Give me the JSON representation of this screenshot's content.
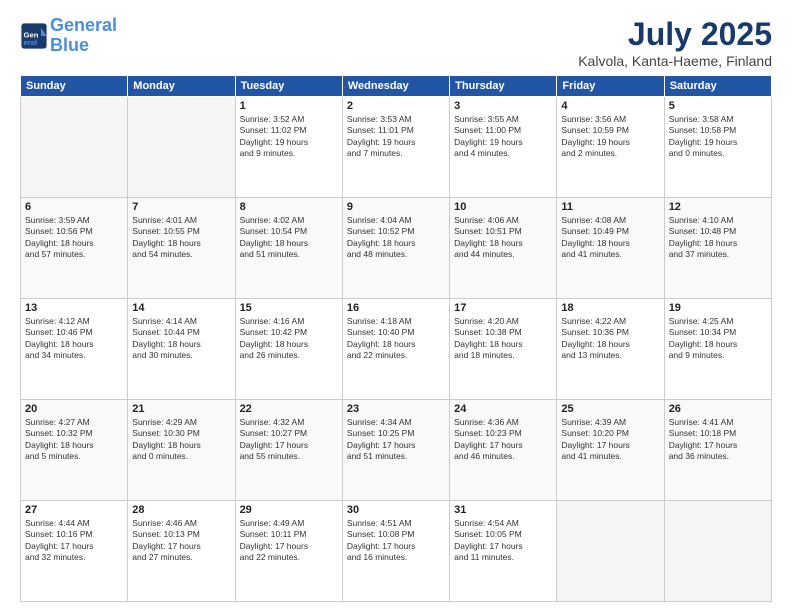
{
  "logo": {
    "line1": "General",
    "line2": "Blue"
  },
  "title": "July 2025",
  "subtitle": "Kalvola, Kanta-Haeme, Finland",
  "days_header": [
    "Sunday",
    "Monday",
    "Tuesday",
    "Wednesday",
    "Thursday",
    "Friday",
    "Saturday"
  ],
  "weeks": [
    [
      {
        "day": "",
        "info": ""
      },
      {
        "day": "",
        "info": ""
      },
      {
        "day": "1",
        "info": "Sunrise: 3:52 AM\nSunset: 11:02 PM\nDaylight: 19 hours\nand 9 minutes."
      },
      {
        "day": "2",
        "info": "Sunrise: 3:53 AM\nSunset: 11:01 PM\nDaylight: 19 hours\nand 7 minutes."
      },
      {
        "day": "3",
        "info": "Sunrise: 3:55 AM\nSunset: 11:00 PM\nDaylight: 19 hours\nand 4 minutes."
      },
      {
        "day": "4",
        "info": "Sunrise: 3:56 AM\nSunset: 10:59 PM\nDaylight: 19 hours\nand 2 minutes."
      },
      {
        "day": "5",
        "info": "Sunrise: 3:58 AM\nSunset: 10:58 PM\nDaylight: 19 hours\nand 0 minutes."
      }
    ],
    [
      {
        "day": "6",
        "info": "Sunrise: 3:59 AM\nSunset: 10:56 PM\nDaylight: 18 hours\nand 57 minutes."
      },
      {
        "day": "7",
        "info": "Sunrise: 4:01 AM\nSunset: 10:55 PM\nDaylight: 18 hours\nand 54 minutes."
      },
      {
        "day": "8",
        "info": "Sunrise: 4:02 AM\nSunset: 10:54 PM\nDaylight: 18 hours\nand 51 minutes."
      },
      {
        "day": "9",
        "info": "Sunrise: 4:04 AM\nSunset: 10:52 PM\nDaylight: 18 hours\nand 48 minutes."
      },
      {
        "day": "10",
        "info": "Sunrise: 4:06 AM\nSunset: 10:51 PM\nDaylight: 18 hours\nand 44 minutes."
      },
      {
        "day": "11",
        "info": "Sunrise: 4:08 AM\nSunset: 10:49 PM\nDaylight: 18 hours\nand 41 minutes."
      },
      {
        "day": "12",
        "info": "Sunrise: 4:10 AM\nSunset: 10:48 PM\nDaylight: 18 hours\nand 37 minutes."
      }
    ],
    [
      {
        "day": "13",
        "info": "Sunrise: 4:12 AM\nSunset: 10:46 PM\nDaylight: 18 hours\nand 34 minutes."
      },
      {
        "day": "14",
        "info": "Sunrise: 4:14 AM\nSunset: 10:44 PM\nDaylight: 18 hours\nand 30 minutes."
      },
      {
        "day": "15",
        "info": "Sunrise: 4:16 AM\nSunset: 10:42 PM\nDaylight: 18 hours\nand 26 minutes."
      },
      {
        "day": "16",
        "info": "Sunrise: 4:18 AM\nSunset: 10:40 PM\nDaylight: 18 hours\nand 22 minutes."
      },
      {
        "day": "17",
        "info": "Sunrise: 4:20 AM\nSunset: 10:38 PM\nDaylight: 18 hours\nand 18 minutes."
      },
      {
        "day": "18",
        "info": "Sunrise: 4:22 AM\nSunset: 10:36 PM\nDaylight: 18 hours\nand 13 minutes."
      },
      {
        "day": "19",
        "info": "Sunrise: 4:25 AM\nSunset: 10:34 PM\nDaylight: 18 hours\nand 9 minutes."
      }
    ],
    [
      {
        "day": "20",
        "info": "Sunrise: 4:27 AM\nSunset: 10:32 PM\nDaylight: 18 hours\nand 5 minutes."
      },
      {
        "day": "21",
        "info": "Sunrise: 4:29 AM\nSunset: 10:30 PM\nDaylight: 18 hours\nand 0 minutes."
      },
      {
        "day": "22",
        "info": "Sunrise: 4:32 AM\nSunset: 10:27 PM\nDaylight: 17 hours\nand 55 minutes."
      },
      {
        "day": "23",
        "info": "Sunrise: 4:34 AM\nSunset: 10:25 PM\nDaylight: 17 hours\nand 51 minutes."
      },
      {
        "day": "24",
        "info": "Sunrise: 4:36 AM\nSunset: 10:23 PM\nDaylight: 17 hours\nand 46 minutes."
      },
      {
        "day": "25",
        "info": "Sunrise: 4:39 AM\nSunset: 10:20 PM\nDaylight: 17 hours\nand 41 minutes."
      },
      {
        "day": "26",
        "info": "Sunrise: 4:41 AM\nSunset: 10:18 PM\nDaylight: 17 hours\nand 36 minutes."
      }
    ],
    [
      {
        "day": "27",
        "info": "Sunrise: 4:44 AM\nSunset: 10:16 PM\nDaylight: 17 hours\nand 32 minutes."
      },
      {
        "day": "28",
        "info": "Sunrise: 4:46 AM\nSunset: 10:13 PM\nDaylight: 17 hours\nand 27 minutes."
      },
      {
        "day": "29",
        "info": "Sunrise: 4:49 AM\nSunset: 10:11 PM\nDaylight: 17 hours\nand 22 minutes."
      },
      {
        "day": "30",
        "info": "Sunrise: 4:51 AM\nSunset: 10:08 PM\nDaylight: 17 hours\nand 16 minutes."
      },
      {
        "day": "31",
        "info": "Sunrise: 4:54 AM\nSunset: 10:05 PM\nDaylight: 17 hours\nand 11 minutes."
      },
      {
        "day": "",
        "info": ""
      },
      {
        "day": "",
        "info": ""
      }
    ]
  ]
}
